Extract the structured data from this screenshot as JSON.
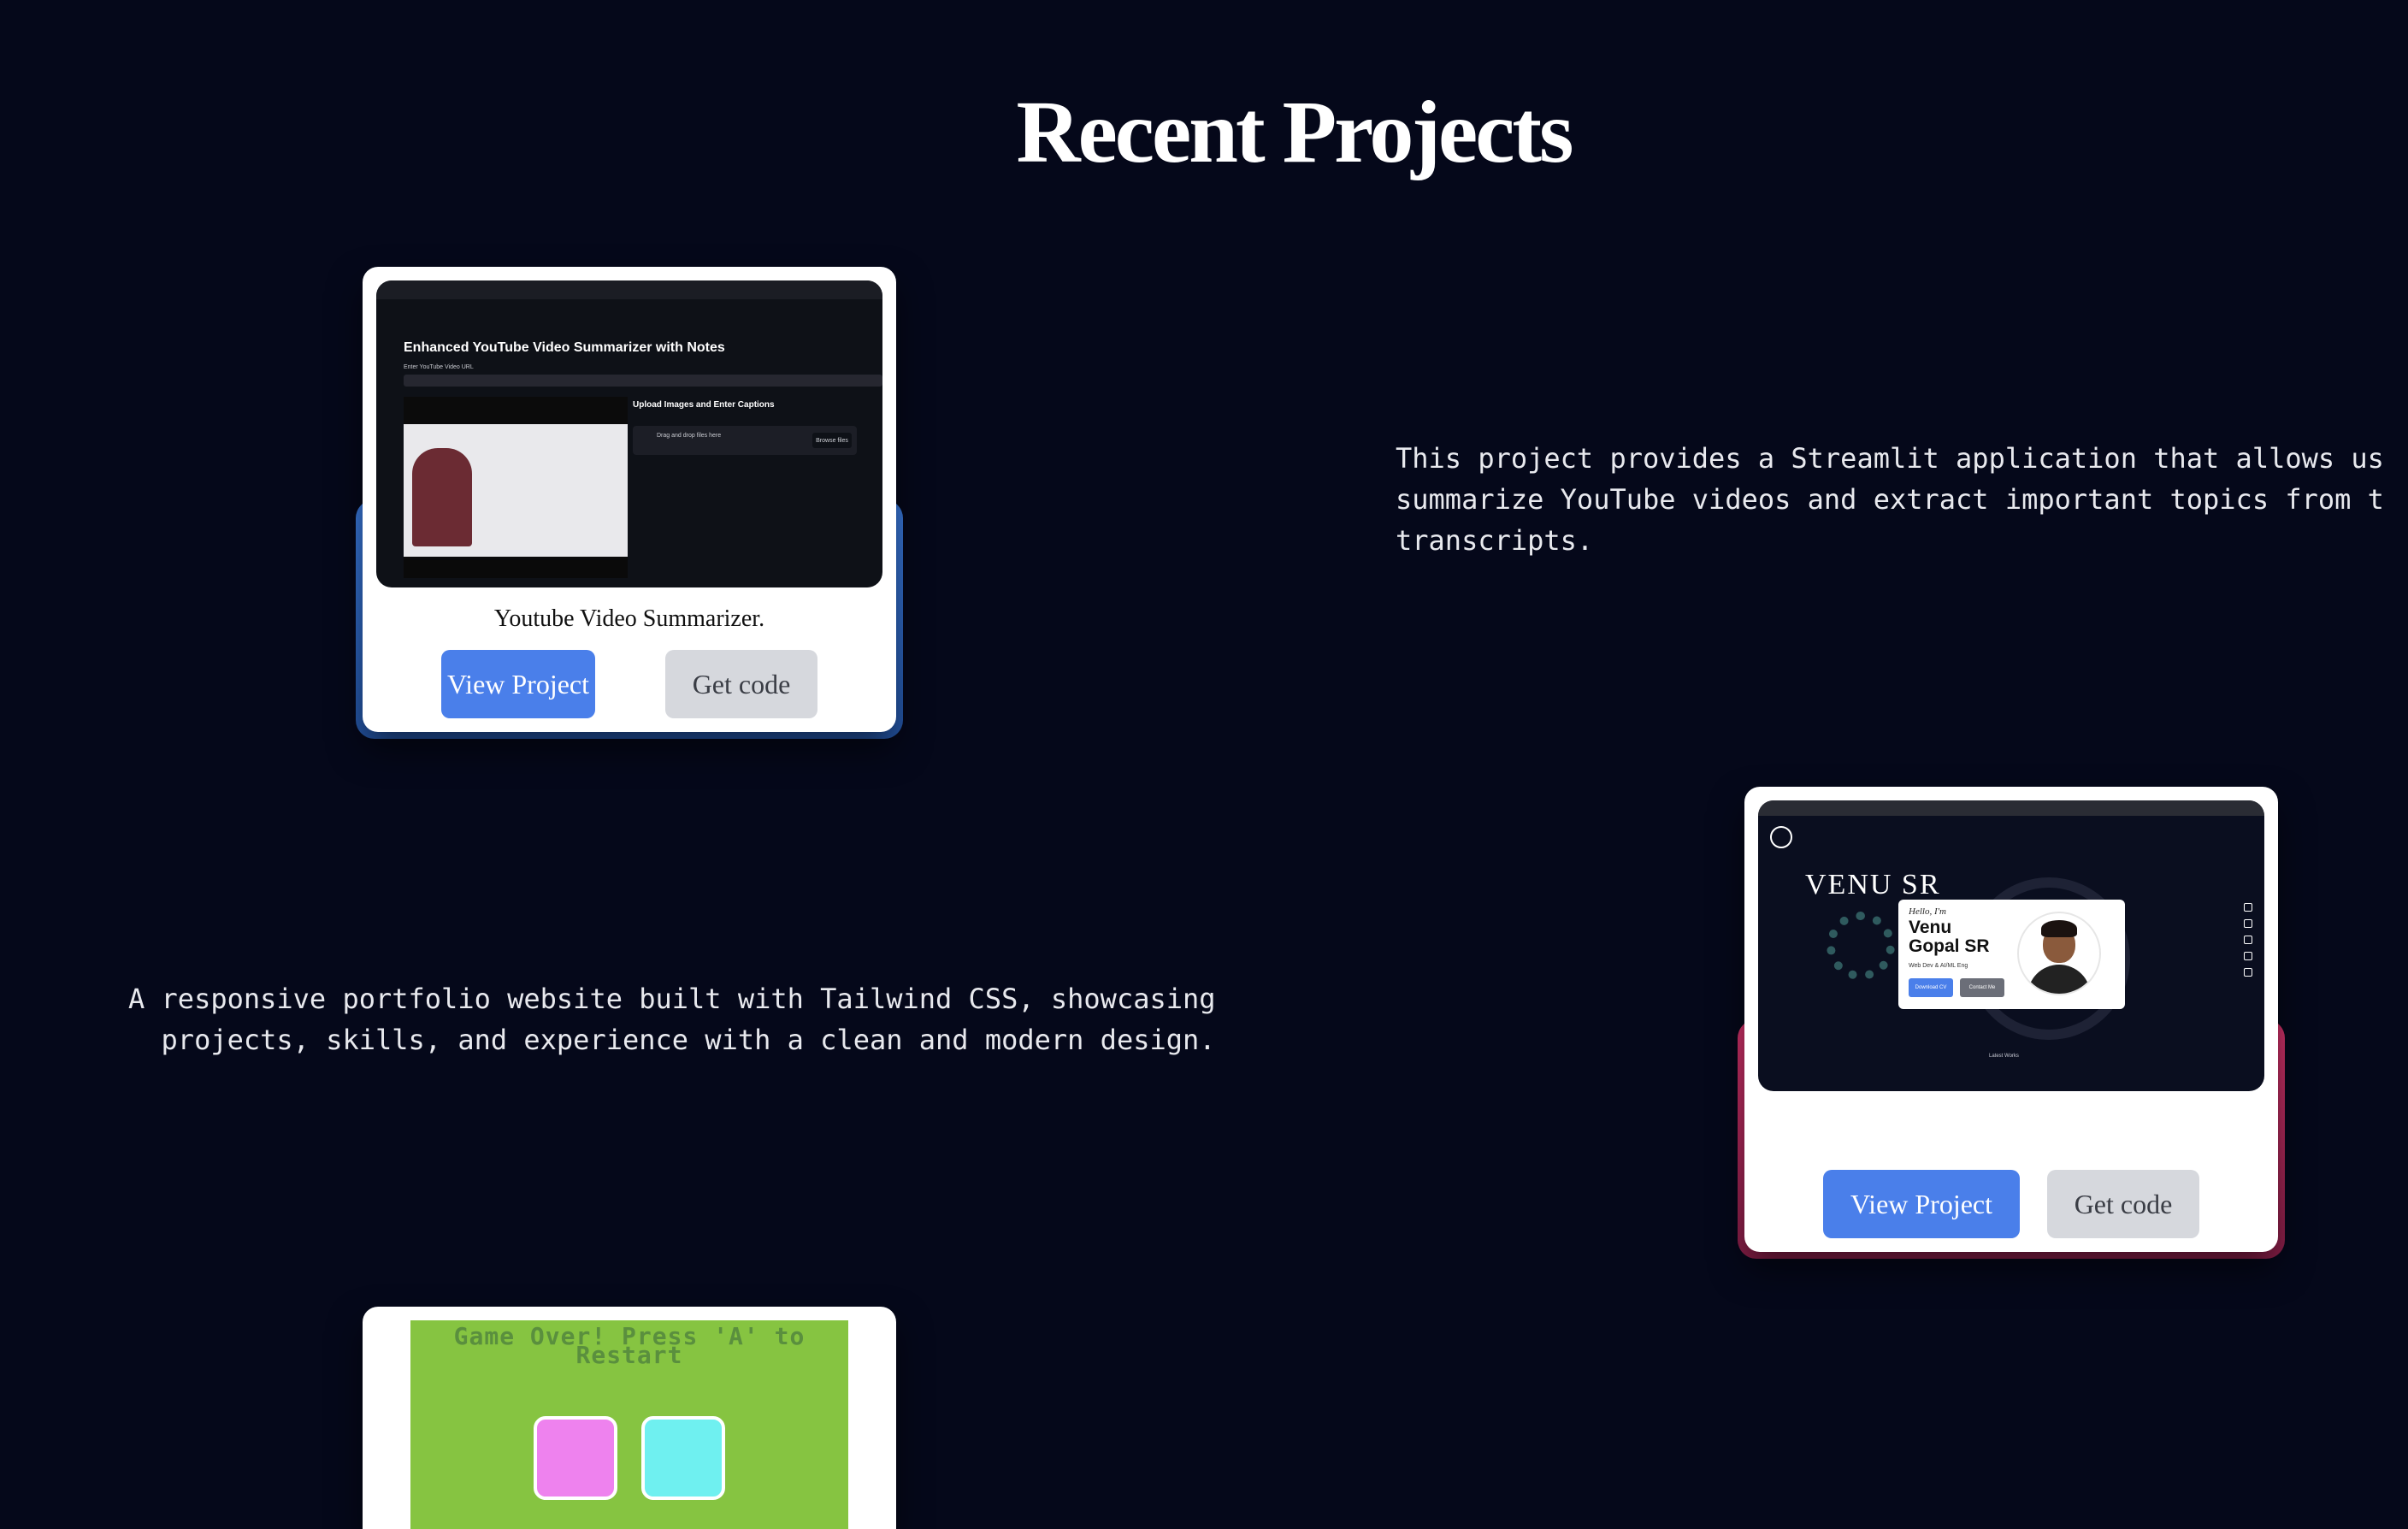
{
  "page": {
    "title": "Recent Projects",
    "background_color": "#05081a"
  },
  "projects": [
    {
      "title": "Youtube Video Summarizer.",
      "description": "This project provides a Streamlit application that allows us\nsummarize YouTube videos and extract important topics from t\ntranscripts.",
      "view_label": "View Project",
      "code_label": "Get code",
      "accent_color": "#3b7be0",
      "screenshot": {
        "heading": "Enhanced YouTube Video Summarizer with Notes",
        "url_label": "Enter YouTube Video URL",
        "upload_title": "Upload Images and Enter Captions",
        "dropzone_text": "Drag and drop files here",
        "browse_label": "Browse files"
      }
    },
    {
      "title": "",
      "description": "A responsive portfolio website built with Tailwind CSS, showcasing\n  projects, skills, and experience with a clean and modern design.",
      "view_label": "View Project",
      "code_label": "Get code",
      "accent_color": "#d6336c",
      "screenshot": {
        "big_name": "VENU SR",
        "hello": "Hello, I'm",
        "name": "Venu\nGopal SR",
        "role": "Web Dev & AI/ML Eng",
        "download_label": "Download CV",
        "contact_label": "Contact Me",
        "latest_label": "Latest Works"
      }
    },
    {
      "screenshot": {
        "game_text": "Game Over! Press 'A' to\nRestart",
        "block_colors": [
          "#ee82ee",
          "#6ff0f0"
        ]
      }
    }
  ],
  "colors": {
    "primary_button": "#4a7fea",
    "secondary_button": "#d6d8dd",
    "card_background": "#ffffff",
    "game_background": "#86c441"
  }
}
